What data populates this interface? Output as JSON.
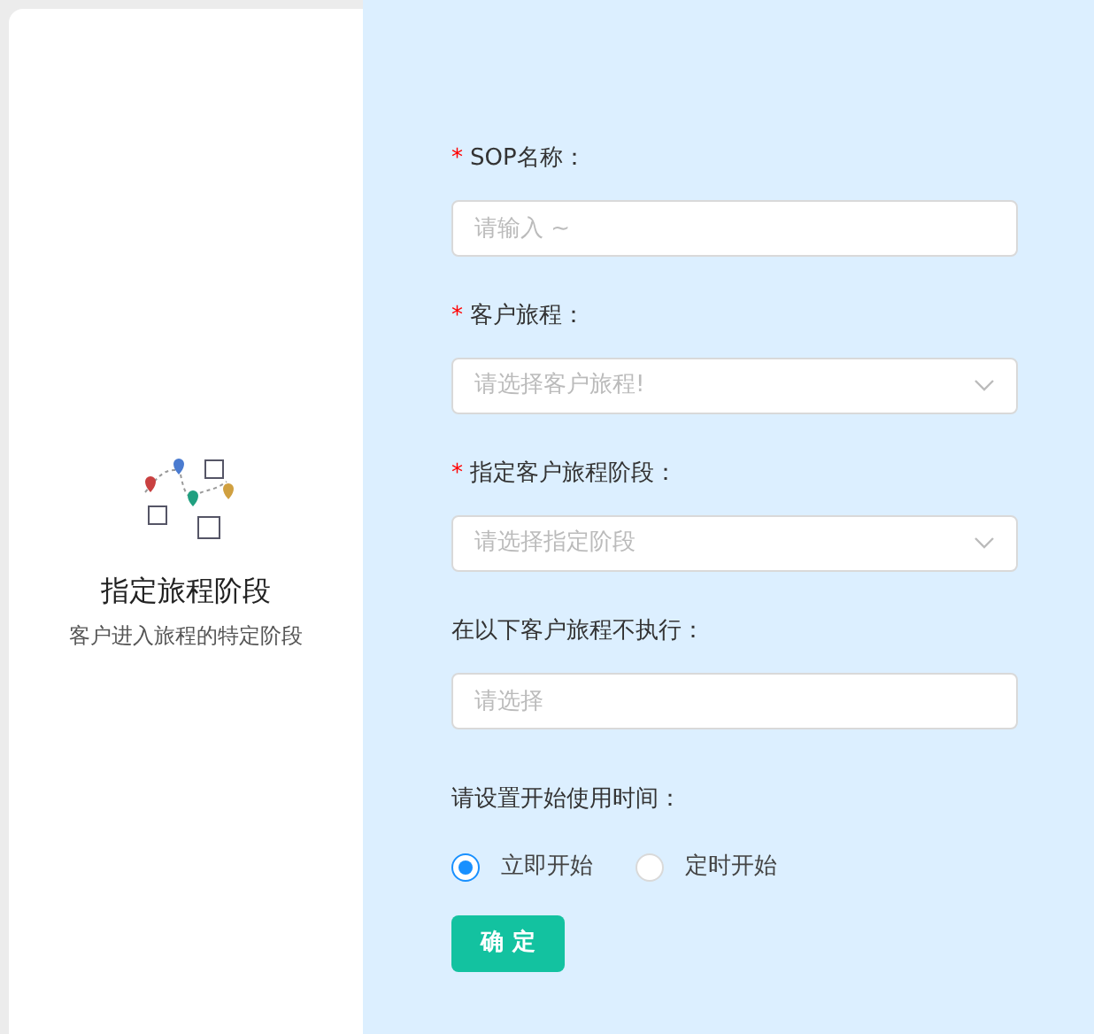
{
  "card": {
    "title": "指定旅程阶段",
    "subtitle": "客户进入旅程的特定阶段"
  },
  "fields": [
    {
      "required_mark": "*",
      "label": "SOP名称：",
      "kind": "input",
      "placeholder": "请输入 ~"
    },
    {
      "required_mark": "*",
      "label": "客户旅程：",
      "kind": "select",
      "placeholder": "请选择客户旅程!"
    },
    {
      "required_mark": "*",
      "label": "指定客户旅程阶段：",
      "kind": "select",
      "placeholder": "请选择指定阶段"
    },
    {
      "label": "在以下客户旅程不执行：",
      "kind": "input",
      "placeholder": "请选择"
    }
  ],
  "start_time": {
    "label": "请设置开始使用时间：",
    "options": [
      {
        "label": "立即开始",
        "selected": true
      },
      {
        "label": "定时开始",
        "selected": false
      }
    ]
  },
  "submit": "确 定"
}
